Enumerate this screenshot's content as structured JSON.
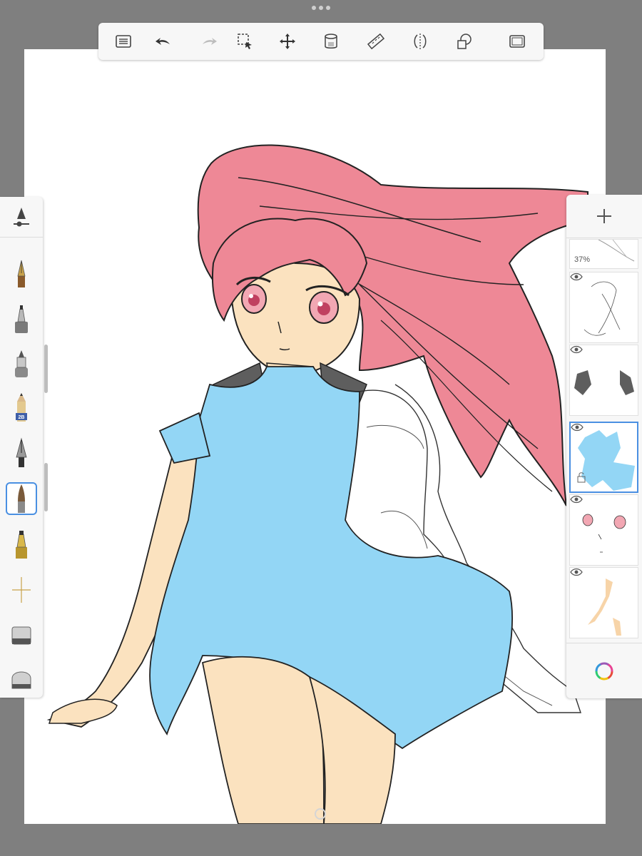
{
  "app": {
    "colors": {
      "background": "#7f7f7f",
      "canvas": "#ffffff",
      "panel": "#f7f7f7",
      "accent": "#4a90e2",
      "hair": "#ee8896",
      "dress": "#93d6f5",
      "skin": "#fbe2bf",
      "shoulder": "#5e5e5e"
    }
  },
  "toolbar": {
    "tools": [
      {
        "name": "list-icon"
      },
      {
        "name": "undo-icon"
      },
      {
        "name": "redo-icon"
      },
      {
        "name": "selection-icon"
      },
      {
        "name": "transform-icon"
      },
      {
        "name": "fill-bucket-icon"
      },
      {
        "name": "ruler-icon"
      },
      {
        "name": "symmetry-icon"
      },
      {
        "name": "shapes-icon"
      },
      {
        "name": "fullscreen-icon"
      }
    ]
  },
  "brushes": [
    {
      "name": "fountain-pen-brush"
    },
    {
      "name": "marker-brush"
    },
    {
      "name": "airbrush-brush"
    },
    {
      "name": "pencil-brush",
      "label": "2B"
    },
    {
      "name": "ink-pen-brush"
    },
    {
      "name": "paintbrush-brush",
      "selected": true
    },
    {
      "name": "chisel-marker-brush"
    },
    {
      "name": "smudge-brush"
    },
    {
      "name": "eraser-brush"
    },
    {
      "name": "soft-eraser-brush"
    }
  ],
  "layers": {
    "items": [
      {
        "name": "layer-sketch",
        "opacity": "37%"
      },
      {
        "name": "layer-lineart",
        "visible": true
      },
      {
        "name": "layer-shadows",
        "visible": true
      },
      {
        "name": "layer-dress",
        "visible": true,
        "selected": true
      },
      {
        "name": "layer-face",
        "visible": true
      },
      {
        "name": "layer-skin",
        "visible": true
      }
    ]
  }
}
